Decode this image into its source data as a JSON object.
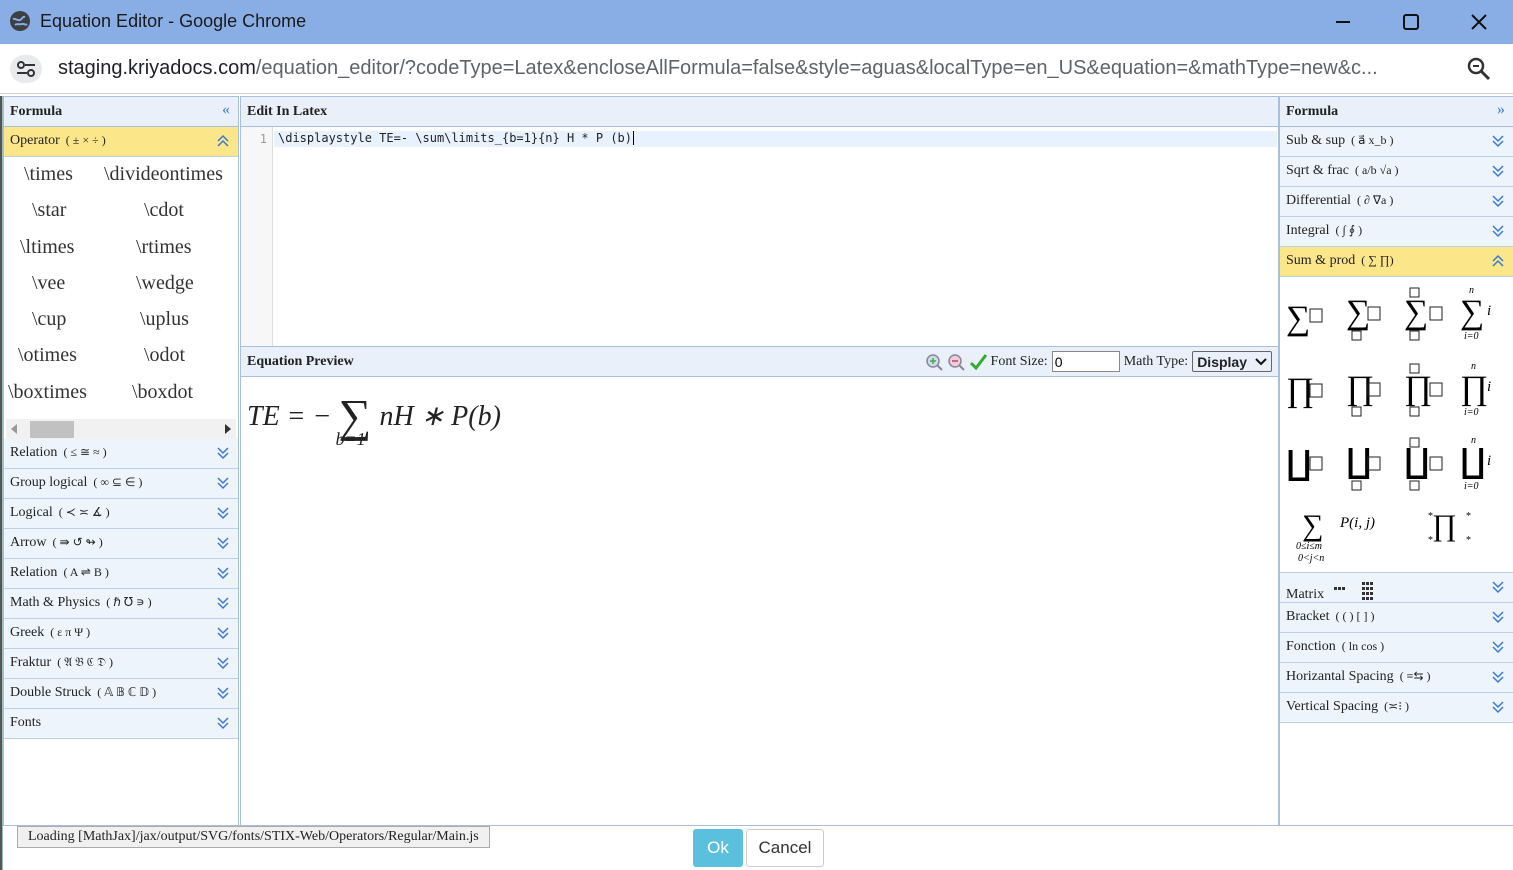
{
  "window": {
    "title": "Equation Editor - Google Chrome"
  },
  "address": {
    "host": "staging.kriyadocs.com",
    "path": "/equation_editor/?codeType=Latex&encloseAllFormula=false&style=aguas&localType=en_US&equation=&mathType=new&c..."
  },
  "left_panel": {
    "title": "Formula",
    "operator_section": {
      "label": "Operator",
      "symbols": "( ± × ÷ )"
    },
    "operators": [
      "\\times",
      "\\divideontimes",
      "\\star",
      "\\cdot",
      "\\ltimes",
      "\\rtimes",
      "\\vee",
      "\\wedge",
      "\\cup",
      "\\uplus",
      "\\otimes",
      "\\odot",
      "\\boxtimes",
      "\\boxdot"
    ],
    "sections": [
      {
        "label": "Relation",
        "symbols": "( ≤  ≅  ≈ )"
      },
      {
        "label": "Group logical",
        "symbols": "( ∞  ⊆  ∈ )"
      },
      {
        "label": "Logical",
        "symbols": "( ≺  ≍  ∡ )"
      },
      {
        "label": "Arrow",
        "symbols": "( ⇛  ↺  ↬ )"
      },
      {
        "label": "Relation",
        "symbols": "( A ⇌ B )"
      },
      {
        "label": "Math & Physics",
        "symbols": "( ℏ  ℧  ∍ )"
      },
      {
        "label": "Greek",
        "symbols": "( ε  π  Ψ )"
      },
      {
        "label": "Fraktur",
        "symbols": "( 𝔄 𝔅 ℭ 𝔇 )"
      },
      {
        "label": "Double Struck",
        "symbols": "( 𝔸 𝔹 ℂ 𝔻 )"
      },
      {
        "label": "Fonts",
        "symbols": ""
      }
    ]
  },
  "editor": {
    "title": "Edit In Latex",
    "line_number": "1",
    "code": "\\displaystyle TE=- \\sum\\limits_{b=1}{n} H * P (b)"
  },
  "preview": {
    "title": "Equation Preview",
    "font_size_label": "Font Size:",
    "font_size_value": "0",
    "math_type_label": "Math Type:",
    "math_type_value": "Display",
    "eq_lhs": "TE = −",
    "eq_rhs": "nH ∗ P(b)",
    "eq_sub": "b=1"
  },
  "right_panel": {
    "title": "Formula",
    "sections_top": [
      {
        "label": "Sub & sup",
        "symbols": "( a⃗  x_b )"
      },
      {
        "label": "Sqrt & frac",
        "symbols": "( a/b  √a )"
      },
      {
        "label": "Differential",
        "symbols": "( ∂  ∇a )"
      },
      {
        "label": "Integral",
        "symbols": "( ∫  ∮ )"
      }
    ],
    "sum_section": {
      "label": "Sum & prod",
      "symbols": "( ∑ ∏)"
    },
    "sum_extra": {
      "p_ij": "P(i, j)",
      "lim1": "0≤i≤m",
      "lim2": "0<j<n",
      "n": "n",
      "i0": "i=0",
      "i": "i"
    },
    "sections_bottom": [
      {
        "label": "Matrix",
        "symbols": ""
      },
      {
        "label": "Bracket",
        "symbols": "( ( )  [ ] )"
      },
      {
        "label": "Fonction",
        "symbols": "( ln  cos )"
      },
      {
        "label": "Horizantal Spacing",
        "symbols": "( ≡⇆ )"
      },
      {
        "label": "Vertical Spacing",
        "symbols": "(≍⁝   )"
      }
    ]
  },
  "footer": {
    "loading": "Loading [MathJax]/jax/output/SVG/fonts/STIX-Web/Operators/Regular/Main.js",
    "ok": "Ok",
    "cancel": "Cancel"
  }
}
